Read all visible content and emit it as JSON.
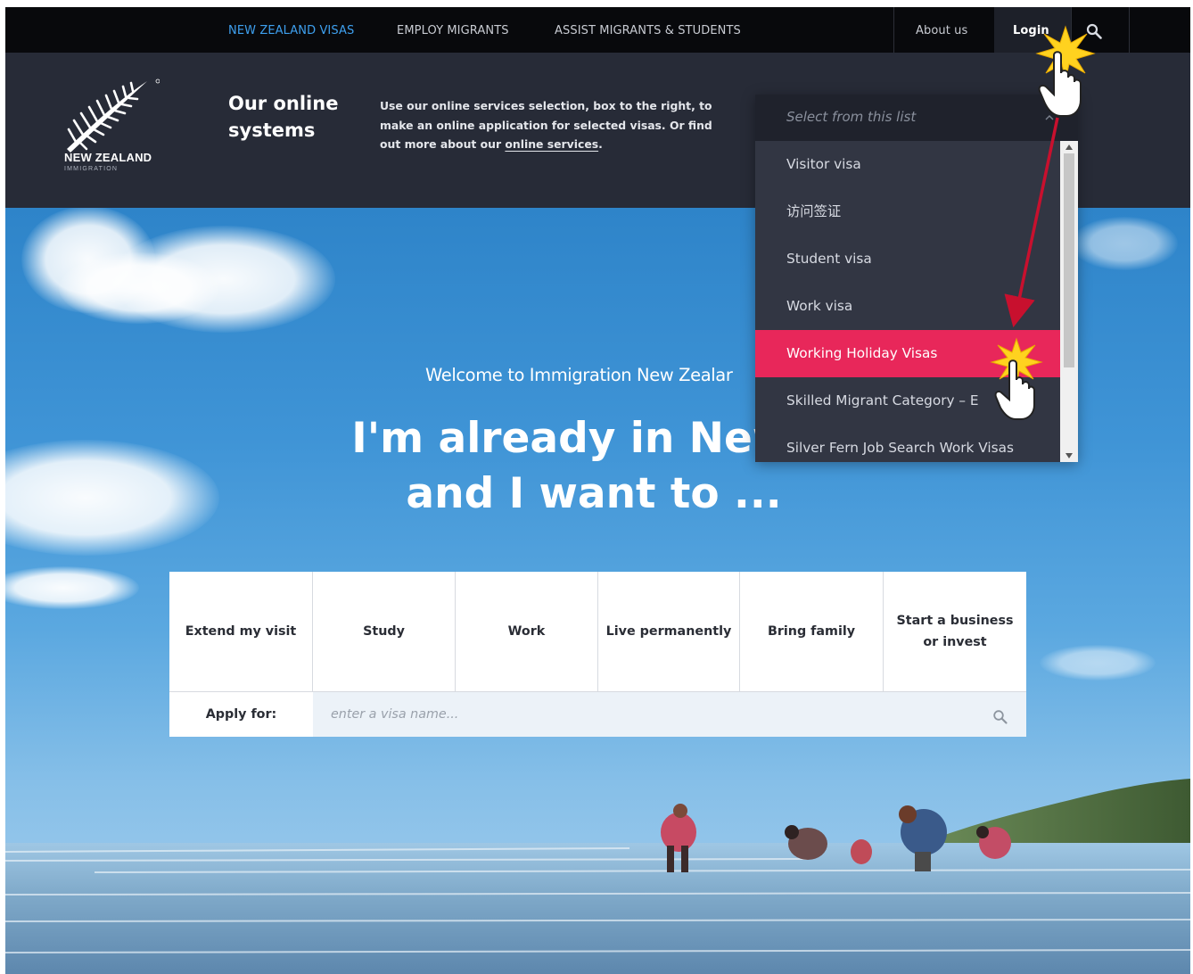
{
  "topnav": {
    "items": [
      {
        "label": "NEW ZEALAND VISAS"
      },
      {
        "label": "EMPLOY MIGRANTS"
      },
      {
        "label": "ASSIST MIGRANTS & STUDENTS"
      }
    ],
    "about": "About us",
    "login": "Login"
  },
  "logo": {
    "name": "NEW ZEALAND",
    "sub": "IMMIGRATION"
  },
  "header": {
    "title": "Our online systems",
    "desc_text": "Use our online services selection, box to the right, to make an online application for selected visas. Or find out more about our ",
    "desc_link": "online services",
    "desc_end": "."
  },
  "dropdown": {
    "placeholder": "Select from this list",
    "items": [
      {
        "label": "Visitor visa"
      },
      {
        "label": "访问签证"
      },
      {
        "label": "Student visa"
      },
      {
        "label": "Work visa"
      },
      {
        "label": "Working Holiday Visas"
      },
      {
        "label": "Skilled Migrant Category – E"
      },
      {
        "label": "Silver Fern Job Search Work Visas"
      }
    ],
    "selected_index": 4
  },
  "hero": {
    "welcome": "Welcome to Immigration New Zealar",
    "line1": "I'm already in New Z",
    "line2": "and I want to ..."
  },
  "options": [
    {
      "label": "Extend my visit"
    },
    {
      "label": "Study"
    },
    {
      "label": "Work"
    },
    {
      "label": "Live permanently"
    },
    {
      "label": "Bring family"
    },
    {
      "label": "Start a business or invest"
    }
  ],
  "apply": {
    "label": "Apply for:",
    "placeholder": "enter a visa name..."
  },
  "colors": {
    "accent_nav": "#3ea0ef",
    "selected_item": "#e8275a",
    "header_bg": "#272b37",
    "annotation_arrow": "#c8102e"
  }
}
